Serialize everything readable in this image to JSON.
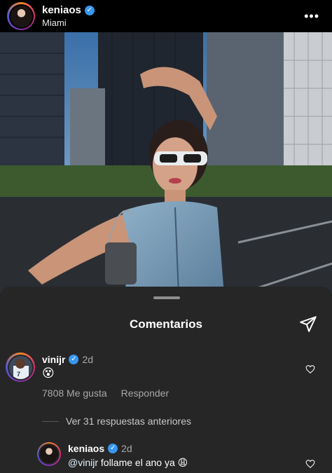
{
  "post": {
    "username": "keniaos",
    "location": "Miami",
    "more_label": "•••"
  },
  "sheet": {
    "title": "Comentarios"
  },
  "comments": [
    {
      "username": "vinijr",
      "time": "2d",
      "text": "😵",
      "likes": "7808 Me gusta",
      "reply_label": "Responder",
      "view_replies": "Ver 31 respuestas anteriores"
    },
    {
      "username": "keniaos",
      "time": "2d",
      "mention": "@vinijr",
      "text": "follame el ano ya 😩"
    }
  ],
  "icons": {
    "verified": "verified-badge-icon",
    "share": "paper-plane-icon",
    "like": "heart-outline-icon"
  },
  "colors": {
    "verified": "#3897f0",
    "sheet_bg": "#262626",
    "muted_text": "#a8a8a8"
  }
}
